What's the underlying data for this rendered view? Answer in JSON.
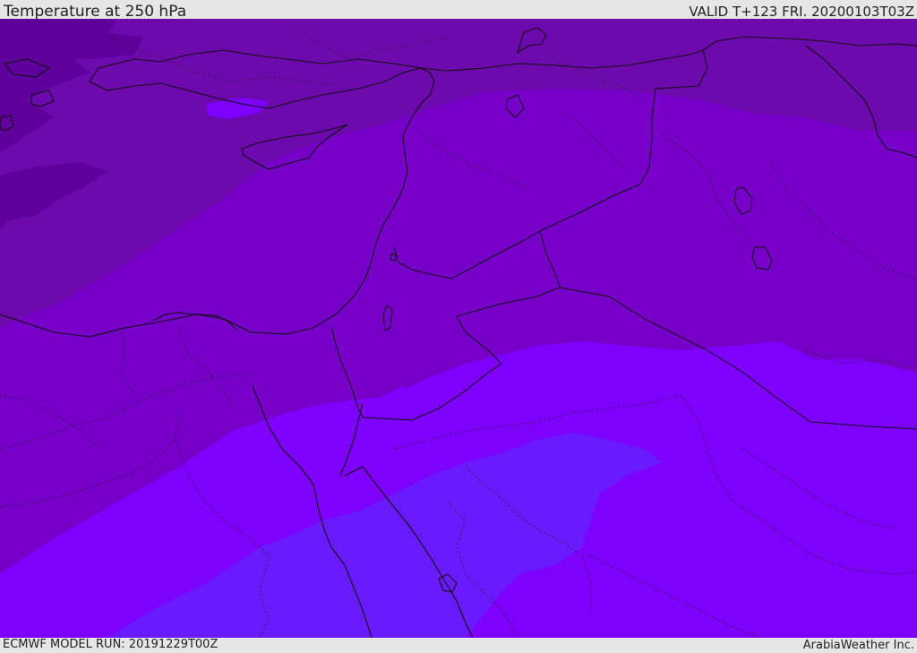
{
  "header": {
    "title": "Temperature at 250 hPa",
    "valid": "VALID T+123 FRI. 20200103T03Z"
  },
  "footer": {
    "model_run": "ECMWF MODEL RUN: 20191229T00Z",
    "credit": "ArabiaWeather Inc."
  },
  "map": {
    "field": "temperature",
    "level": "250 hPa",
    "colors": {
      "darkest": "#5e009c",
      "dark": "#6d0aad",
      "medium": "#7700c9",
      "light": "#7e00ff",
      "bluish": "#6a1aff"
    }
  }
}
